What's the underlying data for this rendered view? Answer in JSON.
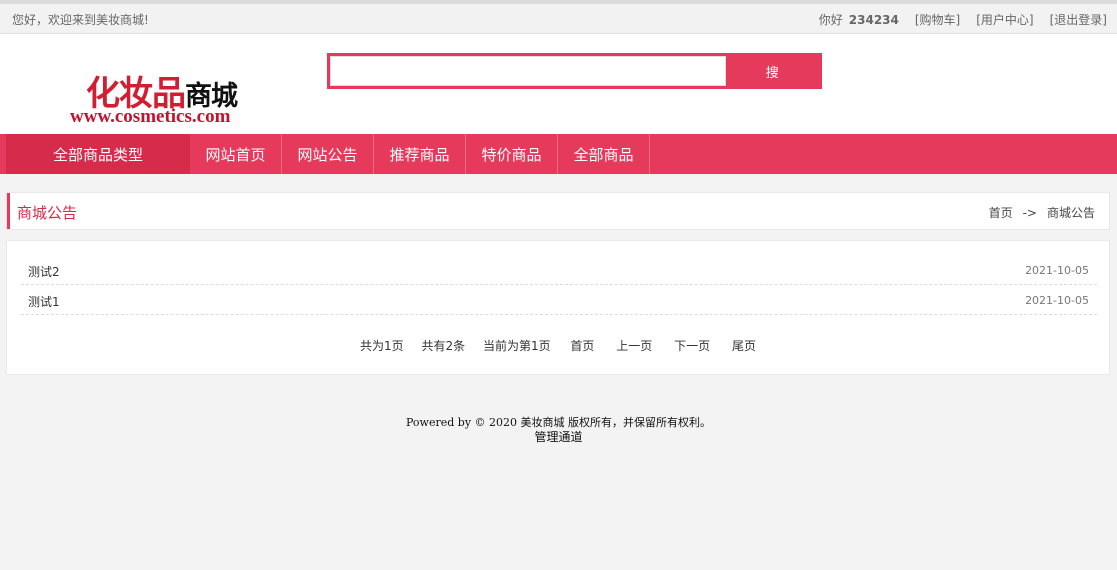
{
  "topbar": {
    "welcome": "您好，欢迎来到美妆商城!",
    "greeting": "你好",
    "username": "234234",
    "links": [
      "[购物车]",
      "[用户中心]",
      "[退出登录]"
    ]
  },
  "logo": {
    "main_red": "化妆品",
    "main_dark": "商城",
    "url": "www.cosmetics.com"
  },
  "search": {
    "placeholder": "",
    "button_label": "搜"
  },
  "nav": {
    "all_categories": "全部商品类型",
    "items": [
      "网站首页",
      "网站公告",
      "推荐商品",
      "特价商品",
      "全部商品"
    ]
  },
  "page": {
    "title": "商城公告",
    "breadcrumb_home": "首页",
    "breadcrumb_arrow": "->",
    "breadcrumb_current": "商城公告"
  },
  "notices": [
    {
      "title": "测试2",
      "date": "2021-10-05"
    },
    {
      "title": "测试1",
      "date": "2021-10-05"
    }
  ],
  "pager": {
    "total_pages": "共为1页",
    "total_items": "共有2条",
    "current_page": "当前为第1页",
    "first": "首页",
    "prev": "上一页",
    "next": "下一页",
    "last": "尾页"
  },
  "footer": {
    "copyright": "Powered by © 2020 美妆商城 版权所有，并保留所有权利。",
    "admin_link": "管理通道"
  },
  "colors": {
    "accent": "#e63a5c",
    "accent_dark": "#d72b4c"
  }
}
